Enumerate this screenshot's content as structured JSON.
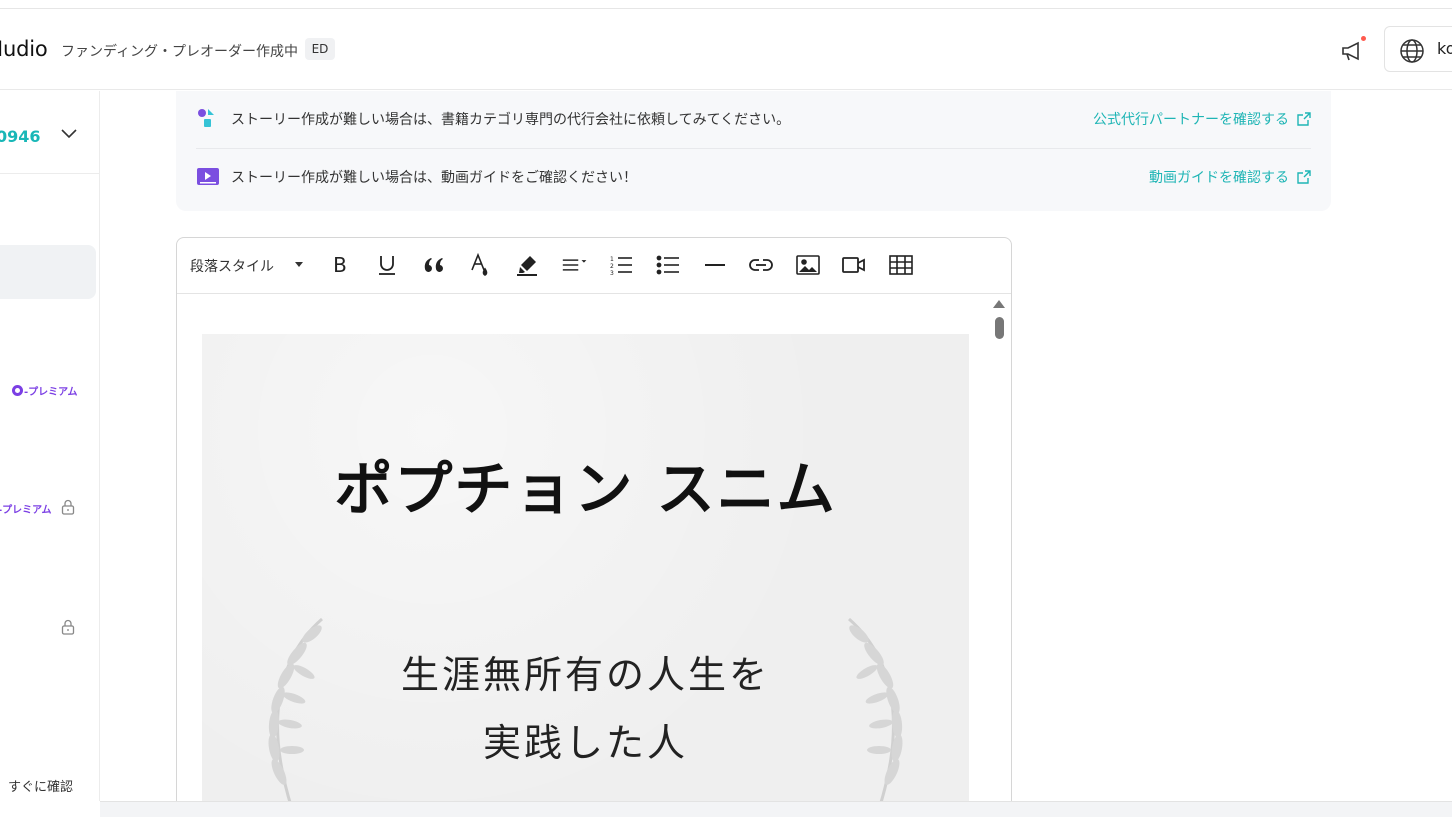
{
  "header": {
    "logo_text": "Iudio",
    "project_title": "ファンディング・プレオーダー作成中",
    "status_badge": "ED",
    "language_label": "ko"
  },
  "sidebar": {
    "project_id": "0946",
    "premium_label_1": "-プレミアム",
    "premium_label_2": "-プレミアム",
    "confirm_link": "すぐに確認"
  },
  "notices": [
    {
      "icon": "partner-icon",
      "text": "ストーリー作成が難しい場合は、書籍カテゴリ専門の代行会社に依頼してみてください。",
      "link": "公式代行パートナーを確認する"
    },
    {
      "icon": "video-guide-icon",
      "text": "ストーリー作成が難しい場合は、動画ガイドをご確認ください！",
      "link": "動画ガイドを確認する"
    }
  ],
  "editor": {
    "paragraph_style": "段落スタイル",
    "toolbar_icons": [
      "bold-icon",
      "underline-icon",
      "quote-icon",
      "font-color-icon",
      "highlight-icon",
      "align-icon",
      "ordered-list-icon",
      "bullet-list-icon",
      "horizontal-rule-icon",
      "link-icon",
      "image-icon",
      "video-icon",
      "table-icon"
    ],
    "bold_glyph": "B",
    "cover": {
      "title": "ポプチョン スニム",
      "subtitle_line1": "生涯無所有の人生を",
      "subtitle_line2": "実践した人"
    }
  },
  "colors": {
    "accent": "#1fb5b5",
    "premium": "#7b3fe4",
    "notification_dot": "#ff5a4e"
  }
}
